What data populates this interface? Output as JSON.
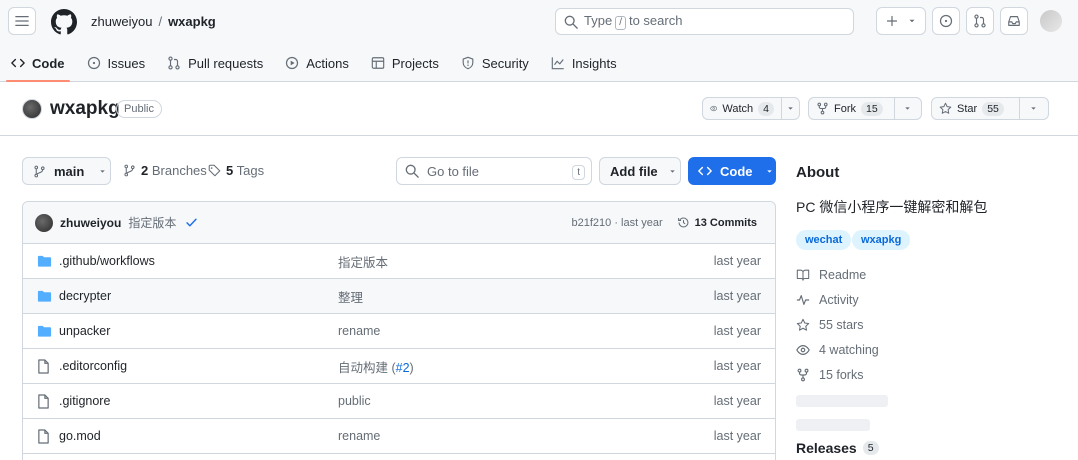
{
  "header": {
    "owner": "zhuweiyou",
    "separator": "/",
    "repo": "wxapkg",
    "search_prefix": "Type",
    "search_key": "/",
    "search_suffix": "to search"
  },
  "tabs": [
    {
      "label": "Code",
      "icon": "code-icon"
    },
    {
      "label": "Issues",
      "icon": "issue-icon"
    },
    {
      "label": "Pull requests",
      "icon": "pull-request-icon"
    },
    {
      "label": "Actions",
      "icon": "play-icon"
    },
    {
      "label": "Projects",
      "icon": "table-icon"
    },
    {
      "label": "Security",
      "icon": "shield-icon"
    },
    {
      "label": "Insights",
      "icon": "graph-icon"
    }
  ],
  "repo": {
    "name": "wxapkg",
    "visibility": "Public",
    "watch_label": "Watch",
    "watch_count": "4",
    "fork_label": "Fork",
    "fork_count": "15",
    "star_label": "Star",
    "star_count": "55"
  },
  "filenav": {
    "branch": "main",
    "branches_count": "2",
    "branches_label": "Branches",
    "tags_count": "5",
    "tags_label": "Tags",
    "goto_placeholder": "Go to file",
    "goto_key": "t",
    "add_file": "Add file",
    "code": "Code"
  },
  "commit": {
    "user": "zhuweiyou",
    "message": "指定版本",
    "hash_time": "b21f210 · last year",
    "commits": "13 Commits"
  },
  "files": [
    {
      "name": ".github/workflows",
      "type": "folder",
      "message": "指定版本",
      "pr": "",
      "when": "last year"
    },
    {
      "name": "decrypter",
      "type": "folder",
      "message": "整理",
      "pr": "",
      "when": "last year"
    },
    {
      "name": "unpacker",
      "type": "folder",
      "message": "rename",
      "pr": "",
      "when": "last year"
    },
    {
      "name": ".editorconfig",
      "type": "file",
      "message": "自动构建 (",
      "pr": "#2",
      "pr_close": ")",
      "when": "last year"
    },
    {
      "name": ".gitignore",
      "type": "file",
      "message": "public",
      "pr": "",
      "when": "last year"
    },
    {
      "name": "go.mod",
      "type": "file",
      "message": "rename",
      "pr": "",
      "when": "last year"
    }
  ],
  "about": {
    "title": "About",
    "description": "PC 微信小程序一键解密和解包",
    "topics": [
      "wechat",
      "wxapkg"
    ],
    "readme": "Readme",
    "activity": "Activity",
    "stars": "55 stars",
    "watching": "4 watching",
    "forks": "15 forks",
    "releases_label": "Releases",
    "releases_count": "5"
  },
  "colors": {
    "accent": "#1f6feb",
    "link": "#0969da",
    "tab_underline": "#fd8c73",
    "folder": "#54aeff"
  }
}
